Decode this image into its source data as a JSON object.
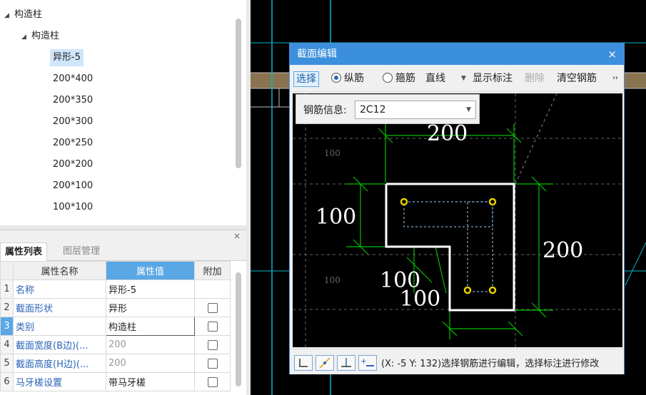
{
  "tree": {
    "root": "构造柱",
    "child": "构造柱",
    "items": [
      "异形-5",
      "200*400",
      "200*350",
      "200*300",
      "200*250",
      "200*200",
      "200*100",
      "100*100"
    ],
    "selected_index": 0
  },
  "props_panel": {
    "close_label": "×",
    "tabs": [
      "属性列表",
      "图层管理"
    ],
    "columns": [
      "属性名称",
      "属性值",
      "附加"
    ],
    "rows": [
      {
        "idx": "1",
        "name": "名称",
        "value": "异形-5",
        "has_checkbox": false
      },
      {
        "idx": "2",
        "name": "截面形状",
        "value": "异形",
        "has_checkbox": true
      },
      {
        "idx": "3",
        "name": "类别",
        "value": "构造柱",
        "has_checkbox": true
      },
      {
        "idx": "4",
        "name": "截面宽度(B边)(...",
        "value": "200",
        "has_checkbox": true
      },
      {
        "idx": "5",
        "name": "截面高度(H边)(...",
        "value": "200",
        "has_checkbox": true
      },
      {
        "idx": "6",
        "name": "马牙槎设置",
        "value": "带马牙槎",
        "has_checkbox": true
      }
    ]
  },
  "dialog": {
    "title": "截面编辑",
    "close_label": "×",
    "toolbar": {
      "select": "选择",
      "longitudinal": "纵筋",
      "stirrup": "箍筋",
      "line_mode": "直线",
      "show_dim": "显示标注",
      "delete": "删除",
      "clear_rebar": "清空钢筋",
      "more": "››"
    },
    "rebar_info_label": "钢筋信息:",
    "rebar_info_value": "2C12",
    "dimensions": {
      "top": "200",
      "left": "100",
      "right": "200",
      "inner_a": "100",
      "inner_b": "100",
      "grid_a": "100",
      "grid_b": "100"
    },
    "status_text": "(X: -5 Y: 132)选择钢筋进行编辑，选择标注进行修改"
  },
  "colors": {
    "accent": "#3c8fdc",
    "dim_green": "#00c000",
    "rebar_yellow": "#e8d000",
    "grid_cyan": "#00b8c8"
  }
}
